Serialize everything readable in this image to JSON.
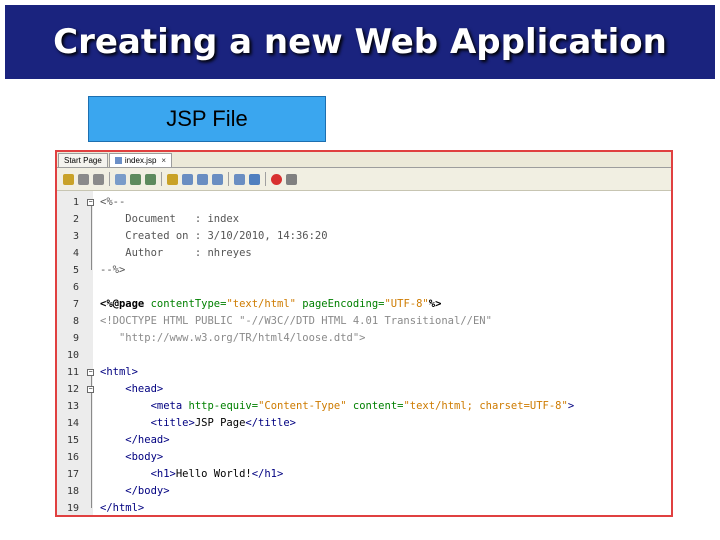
{
  "title": "Creating a new Web Application",
  "label": "JSP File",
  "editor": {
    "tabs": [
      {
        "label": "Start Page",
        "active": false
      },
      {
        "label": "index.jsp",
        "active": true
      }
    ],
    "tab_close": "×",
    "toolbar_icons": [
      "back-icon",
      "history-icon",
      "forward-icon",
      "find-icon",
      "find-prev-icon",
      "find-next-icon",
      "toggle-highlight-icon",
      "toggle-bookmark-icon",
      "prev-bookmark-icon",
      "next-bookmark-icon",
      "shift-left-icon",
      "shift-right-icon",
      "macro-record-icon",
      "macro-stop-icon"
    ],
    "lines": [
      {
        "n": "1",
        "segments": [
          {
            "t": "<%--",
            "c": "c-comment"
          }
        ]
      },
      {
        "n": "2",
        "segments": [
          {
            "t": "    Document   : index",
            "c": "c-comment"
          }
        ]
      },
      {
        "n": "3",
        "segments": [
          {
            "t": "    Created on : 3/10/2010, 14:36:20",
            "c": "c-comment"
          }
        ]
      },
      {
        "n": "4",
        "segments": [
          {
            "t": "    Author     : nhreyes",
            "c": "c-comment"
          }
        ]
      },
      {
        "n": "5",
        "segments": [
          {
            "t": "--%>",
            "c": "c-comment"
          }
        ]
      },
      {
        "n": "6",
        "segments": [
          {
            "t": "",
            "c": ""
          }
        ]
      },
      {
        "n": "7",
        "segments": [
          {
            "t": "<%@page ",
            "c": "c-bold"
          },
          {
            "t": "contentType=",
            "c": "c-attr"
          },
          {
            "t": "\"text/html\" ",
            "c": "c-str"
          },
          {
            "t": "pageEncoding=",
            "c": "c-attr"
          },
          {
            "t": "\"UTF-8\"",
            "c": "c-str"
          },
          {
            "t": "%>",
            "c": "c-bold"
          }
        ]
      },
      {
        "n": "8",
        "segments": [
          {
            "t": "<!DOCTYPE HTML PUBLIC \"-//W3C//DTD HTML 4.01 Transitional//EN\"",
            "c": "c-doctype"
          }
        ]
      },
      {
        "n": "9",
        "segments": [
          {
            "t": "   \"http://www.w3.org/TR/html4/loose.dtd\">",
            "c": "c-doctype"
          }
        ]
      },
      {
        "n": "10",
        "segments": [
          {
            "t": "",
            "c": ""
          }
        ]
      },
      {
        "n": "11",
        "segments": [
          {
            "t": "<html>",
            "c": "c-tag"
          }
        ]
      },
      {
        "n": "12",
        "segments": [
          {
            "t": "    <head>",
            "c": "c-tag"
          }
        ]
      },
      {
        "n": "13",
        "segments": [
          {
            "t": "        <meta ",
            "c": "c-tag"
          },
          {
            "t": "http-equiv=",
            "c": "c-attr"
          },
          {
            "t": "\"Content-Type\" ",
            "c": "c-str"
          },
          {
            "t": "content=",
            "c": "c-attr"
          },
          {
            "t": "\"text/html; charset=UTF-8\"",
            "c": "c-str"
          },
          {
            "t": ">",
            "c": "c-tag"
          }
        ]
      },
      {
        "n": "14",
        "segments": [
          {
            "t": "        <title>",
            "c": "c-tag"
          },
          {
            "t": "JSP Page",
            "c": ""
          },
          {
            "t": "</title>",
            "c": "c-tag"
          }
        ]
      },
      {
        "n": "15",
        "segments": [
          {
            "t": "    </head>",
            "c": "c-tag"
          }
        ]
      },
      {
        "n": "16",
        "segments": [
          {
            "t": "    <body>",
            "c": "c-tag"
          }
        ]
      },
      {
        "n": "17",
        "segments": [
          {
            "t": "        <h1>",
            "c": "c-tag"
          },
          {
            "t": "Hello World!",
            "c": ""
          },
          {
            "t": "</h1>",
            "c": "c-tag"
          }
        ]
      },
      {
        "n": "18",
        "segments": [
          {
            "t": "    </body>",
            "c": "c-tag"
          }
        ]
      },
      {
        "n": "19",
        "segments": [
          {
            "t": "</html>",
            "c": "c-tag"
          }
        ]
      }
    ]
  }
}
